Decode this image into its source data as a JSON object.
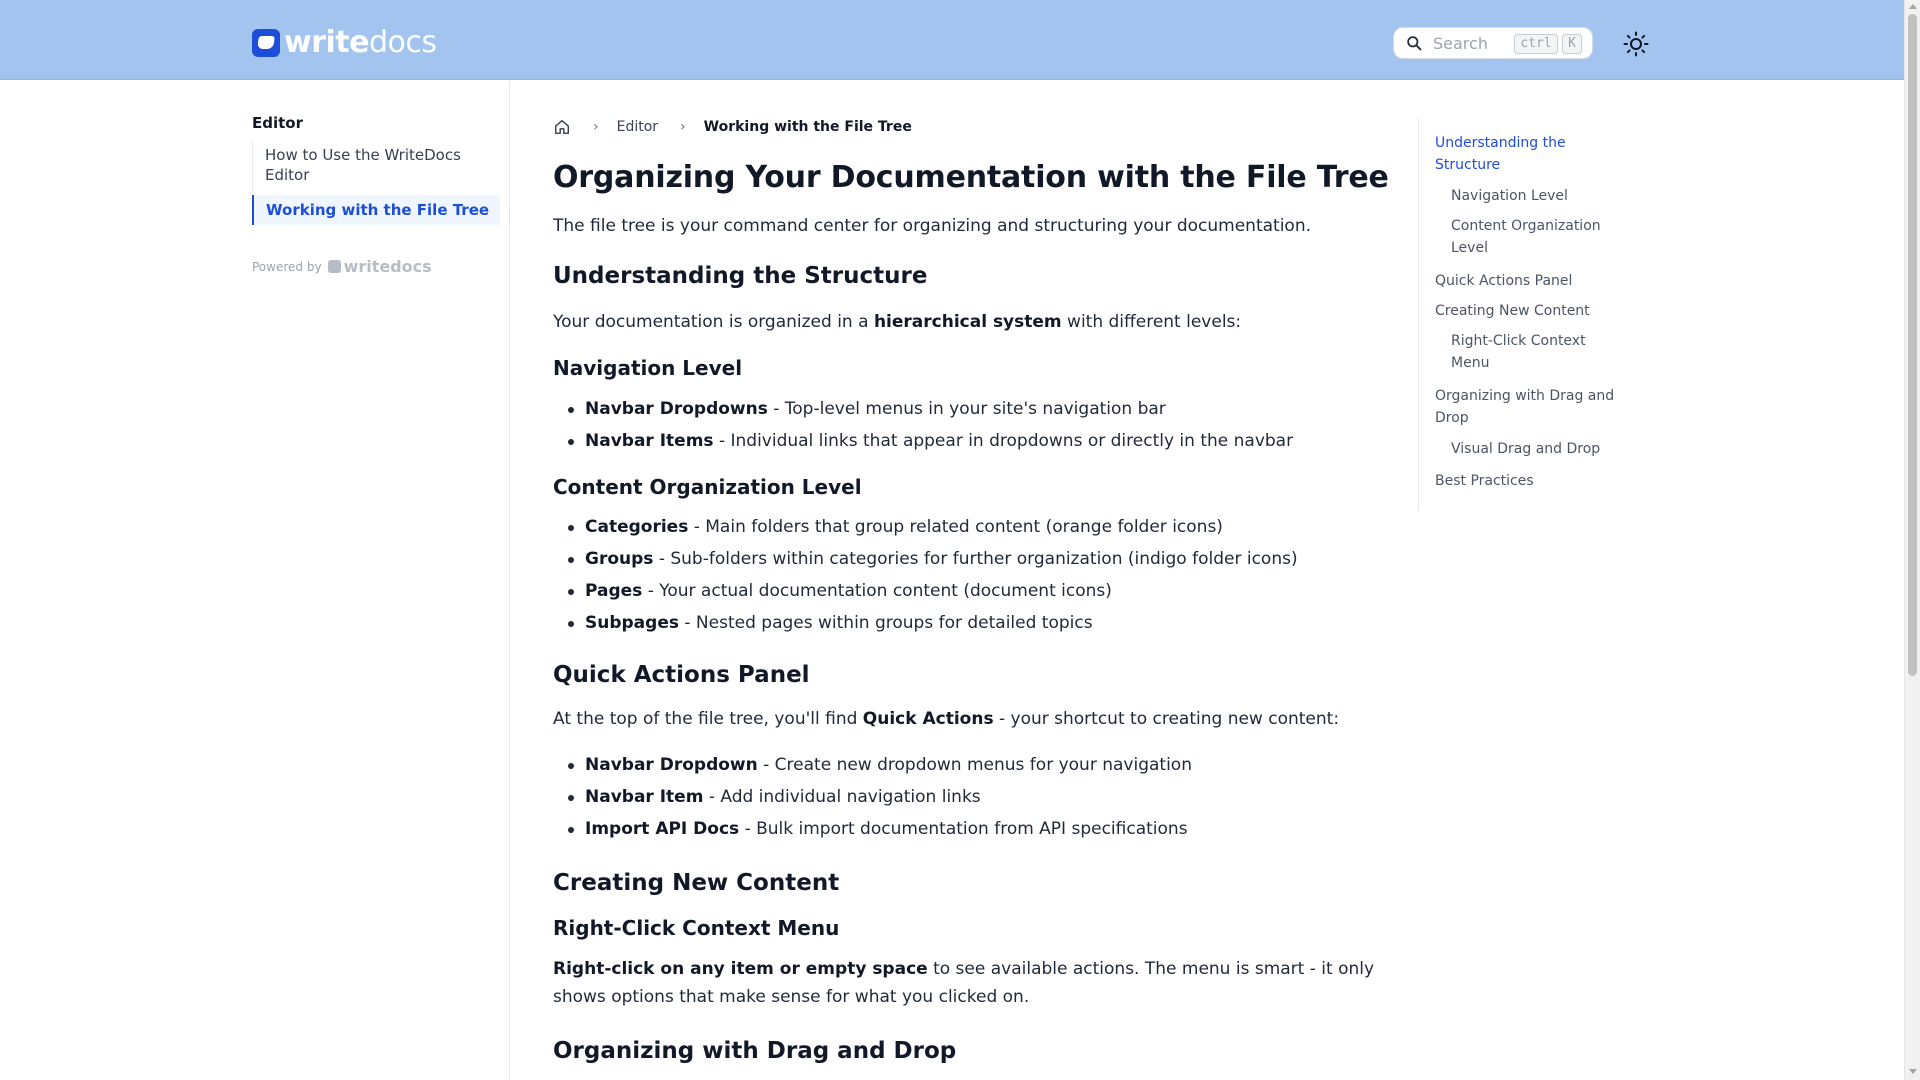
{
  "header": {
    "logo_primary": "write",
    "logo_secondary": "docs",
    "search_placeholder": "Search",
    "shortcut_ctrl": "ctrl",
    "shortcut_key": "K",
    "theme_icon": "sun-icon",
    "background_color": "#a3c4ef"
  },
  "sidebar": {
    "heading": "Editor",
    "items": [
      {
        "label": "How to Use the WriteDocs Editor",
        "active": false
      },
      {
        "label": "Working with the File Tree",
        "active": true
      }
    ],
    "powered_by": "Powered by",
    "powered_logo": "writedocs"
  },
  "breadcrumb": {
    "home_icon": "home-icon",
    "items": [
      "Editor",
      "Working with the File Tree"
    ]
  },
  "article": {
    "title": "Organizing Your Documentation with the File Tree",
    "intro": "The file tree is your command center for organizing and structuring your documentation.",
    "understanding": {
      "heading": "Understanding the Structure",
      "text_before": "Your documentation is organized in a ",
      "text_bold": "hierarchical system",
      "text_after": " with different levels:"
    },
    "navigation_level": {
      "heading": "Navigation Level",
      "items": [
        {
          "term": "Navbar Dropdowns",
          "desc": " - Top-level menus in your site's navigation bar"
        },
        {
          "term": "Navbar Items",
          "desc": " - Individual links that appear in dropdowns or directly in the navbar"
        }
      ]
    },
    "content_level": {
      "heading": "Content Organization Level",
      "items": [
        {
          "term": "Categories",
          "desc": " - Main folders that group related content (orange folder icons)"
        },
        {
          "term": "Groups",
          "desc": " - Sub-folders within categories for further organization (indigo folder icons)"
        },
        {
          "term": "Pages",
          "desc": " - Your actual documentation content (document icons)"
        },
        {
          "term": "Subpages",
          "desc": " - Nested pages within groups for detailed topics"
        }
      ]
    },
    "quick_actions": {
      "heading": "Quick Actions Panel",
      "text_before": "At the top of the file tree, you'll find ",
      "text_bold": "Quick Actions",
      "text_after": " - your shortcut to creating new content:",
      "items": [
        {
          "term": "Navbar Dropdown",
          "desc": " - Create new dropdown menus for your navigation"
        },
        {
          "term": "Navbar Item",
          "desc": " - Add individual navigation links"
        },
        {
          "term": "Import API Docs",
          "desc": " - Bulk import documentation from API specifications"
        }
      ]
    },
    "creating": {
      "heading": "Creating New Content",
      "subheading": "Right-Click Context Menu",
      "text_bold": "Right-click on any item or empty space",
      "text_after": " to see available actions. The menu is smart - it only",
      "text_line2": "shows options that make sense for what you clicked on."
    },
    "drag_drop": {
      "heading": "Organizing with Drag and Drop"
    }
  },
  "toc": {
    "items": [
      {
        "label_line1": "Understanding the",
        "label_line2": "Structure",
        "level": 1,
        "active": true
      },
      {
        "label_line1": "Navigation Level",
        "label_line2": "",
        "level": 2,
        "active": false
      },
      {
        "label_line1": "Content Organization",
        "label_line2": "Level",
        "level": 2,
        "active": false
      },
      {
        "label_line1": "Quick Actions Panel",
        "label_line2": "",
        "level": 1,
        "active": false
      },
      {
        "label_line1": "Creating New Content",
        "label_line2": "",
        "level": 1,
        "active": false
      },
      {
        "label_line1": "Right-Click Context",
        "label_line2": "Menu",
        "level": 2,
        "active": false
      },
      {
        "label_line1": "Organizing with Drag and",
        "label_line2": "Drop",
        "level": 1,
        "active": false
      },
      {
        "label_line1": "Visual Drag and Drop",
        "label_line2": "",
        "level": 2,
        "active": false
      },
      {
        "label_line1": "Best Practices",
        "label_line2": "",
        "level": 1,
        "active": false
      }
    ]
  },
  "colors": {
    "accent": "#1d4ed8",
    "text": "#1f2937",
    "muted": "#6b7280"
  }
}
